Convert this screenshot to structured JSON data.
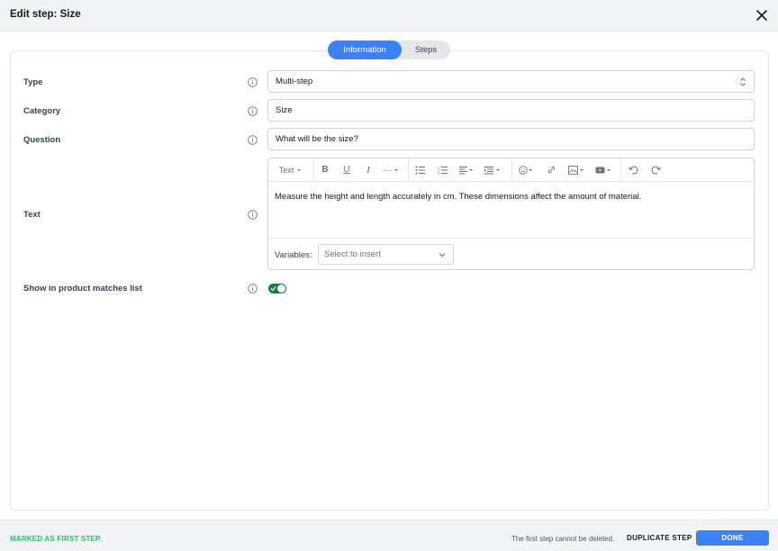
{
  "modal": {
    "title": "Edit step: Size"
  },
  "tabs": [
    {
      "label": "Information",
      "active": true
    },
    {
      "label": "Steps",
      "active": false
    }
  ],
  "form": {
    "type": {
      "label": "Type",
      "value": "Multi-step"
    },
    "category": {
      "label": "Category",
      "value": "Size"
    },
    "question": {
      "label": "Question",
      "value": "What will be the size?"
    },
    "text": {
      "label": "Text",
      "content": "Measure the height and length accurately in cm. These dimensions affect the amount of material.",
      "toolbar": {
        "text_style": "Text",
        "more": "···"
      },
      "variables_label": "Variables:",
      "variables_placeholder": "Select to insert"
    },
    "show_in_matches": {
      "label": "Show in product matches list",
      "enabled": true
    }
  },
  "footer": {
    "first_step": "MARKED AS FIRST STEP.",
    "cannot_delete": "The first step cannot be deleted.",
    "duplicate": "DUPLICATE STEP",
    "done": "DONE"
  },
  "colors": {
    "accent": "#3b82f6",
    "success": "#22c55e",
    "toggle_on": "#15803d"
  }
}
